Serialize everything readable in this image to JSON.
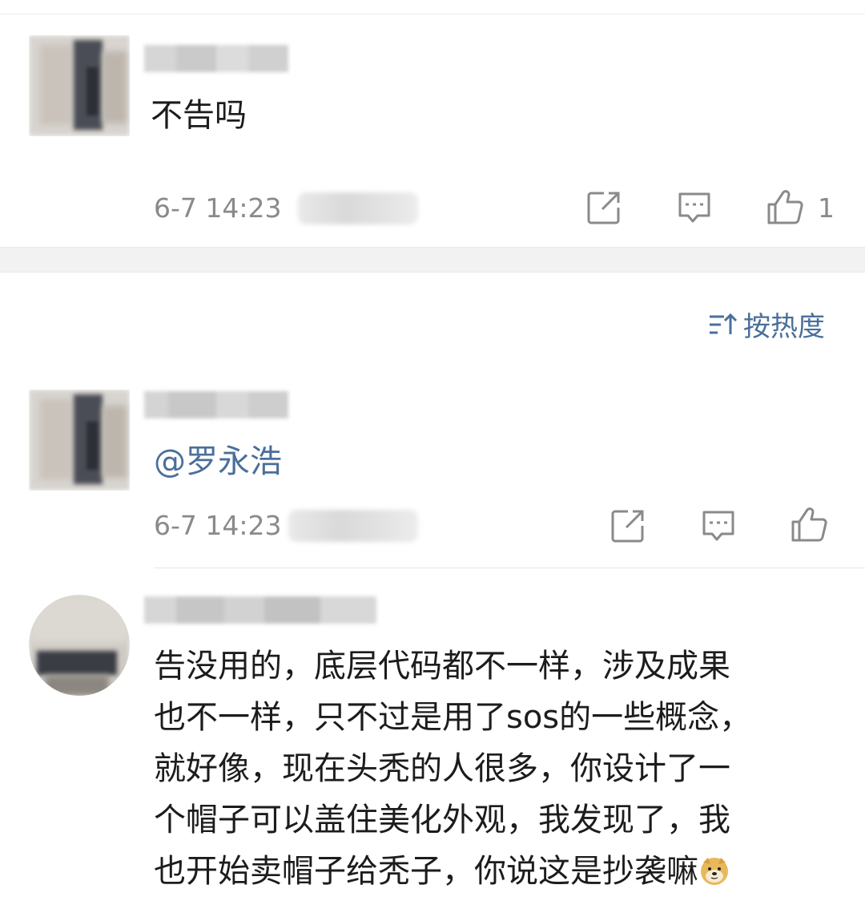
{
  "comments": [
    {
      "text": "不告吗",
      "date": "6-7 14:23",
      "like_count": "1"
    },
    {
      "text": "@罗永浩",
      "date": "6-7 14:23",
      "like_count": ""
    },
    {
      "lines": [
        "告没用的，底层代码都不一样，涉及成果",
        "也不一样，只不过是用了sos的一些概念，",
        "就好像，现在头秃的人很多，你设计了一",
        "个帽子可以盖住美化外观，我发现了，我",
        "也开始卖帽子给秃子，你说这是抄袭嘛"
      ],
      "emoji": "doge-emoji"
    }
  ],
  "sort": {
    "label": "按热度",
    "icon": "sort-icon"
  },
  "colors": {
    "link": "#4a6f9b",
    "meta": "#8a8a8a",
    "text": "#1c1c1c"
  }
}
